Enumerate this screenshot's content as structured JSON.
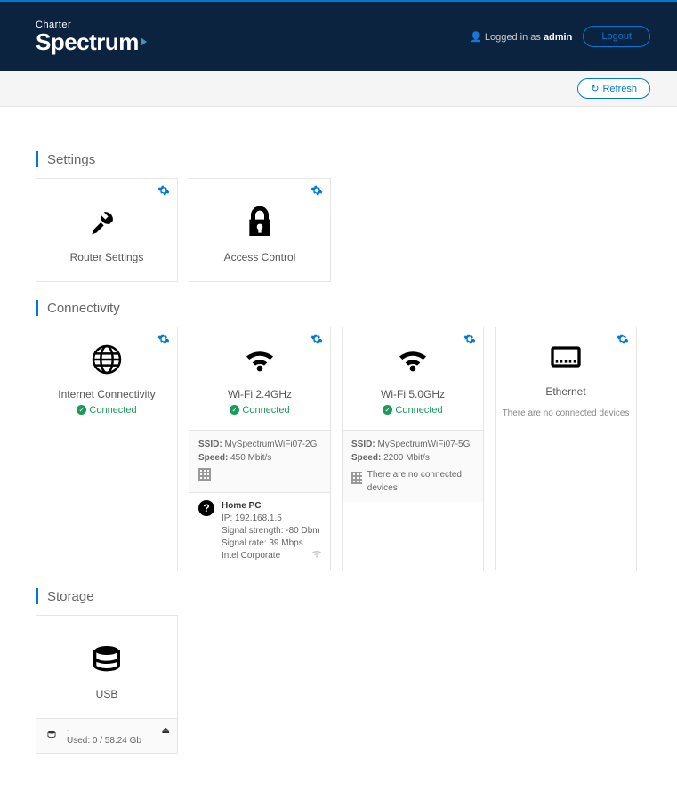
{
  "header": {
    "brand_top": "Charter",
    "brand_main": "Spectrum",
    "logged_in_prefix": "Logged in as ",
    "username": "admin",
    "logout_label": "Logout"
  },
  "subbar": {
    "refresh_label": "Refresh"
  },
  "sections": {
    "settings": {
      "title": "Settings",
      "cards": {
        "router": {
          "title": "Router Settings"
        },
        "access": {
          "title": "Access Control"
        }
      }
    },
    "connectivity": {
      "title": "Connectivity",
      "internet": {
        "title": "Internet Connectivity",
        "status": "Connected"
      },
      "wifi24": {
        "title": "Wi-Fi 2.4GHz",
        "status": "Connected",
        "ssid_label": "SSID:",
        "ssid": "MySpectrumWiFi07-2G",
        "speed_label": "Speed:",
        "speed": "450 Mbit/s",
        "device": {
          "name": "Home PC",
          "ip": "IP: 192.168.1.5",
          "signal_strength": "Signal strength: -80 Dbm",
          "signal_rate": "Signal rate: 39 Mbps",
          "vendor": "Intel Corporate"
        }
      },
      "wifi5": {
        "title": "Wi-Fi 5.0GHz",
        "status": "Connected",
        "ssid_label": "SSID:",
        "ssid": "MySpectrumWiFi07-5G",
        "speed_label": "Speed:",
        "speed": "2200 Mbit/s",
        "no_devices": "There are no connected devices"
      },
      "ethernet": {
        "title": "Ethernet",
        "no_devices": "There are no connected devices"
      }
    },
    "storage": {
      "title": "Storage",
      "usb": {
        "title": "USB",
        "label": "-",
        "used": "Used: 0 / 58.24 Gb"
      }
    }
  }
}
